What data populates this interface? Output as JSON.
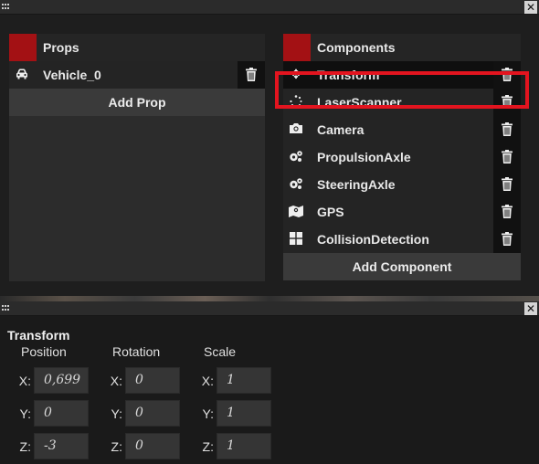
{
  "props_panel": {
    "title": "Props",
    "items": [
      {
        "label": "Vehicle_0",
        "icon": "car-icon"
      }
    ],
    "add_button": "Add Prop"
  },
  "components_panel": {
    "title": "Components",
    "items": [
      {
        "label": "Transform",
        "icon": "move-icon"
      },
      {
        "label": "LaserScanner",
        "icon": "spinner-icon"
      },
      {
        "label": "Camera",
        "icon": "camera-icon"
      },
      {
        "label": "PropulsionAxle",
        "icon": "gears-icon"
      },
      {
        "label": "SteeringAxle",
        "icon": "gears-icon"
      },
      {
        "label": "GPS",
        "icon": "map-icon"
      },
      {
        "label": "CollisionDetection",
        "icon": "windows-icon"
      }
    ],
    "add_button": "Add Component"
  },
  "colors": {
    "accent_swatch": "#a31114",
    "highlight": "#e3141f"
  },
  "inspector": {
    "title": "Transform",
    "columns": [
      "Position",
      "Rotation",
      "Scale"
    ],
    "axes": [
      "X:",
      "Y:",
      "Z:"
    ],
    "position": [
      "0,699",
      "0",
      "-3"
    ],
    "rotation": [
      "0",
      "0",
      "0"
    ],
    "scale": [
      "1",
      "1",
      "1"
    ]
  },
  "window_controls": {
    "close_glyph": "✕"
  }
}
